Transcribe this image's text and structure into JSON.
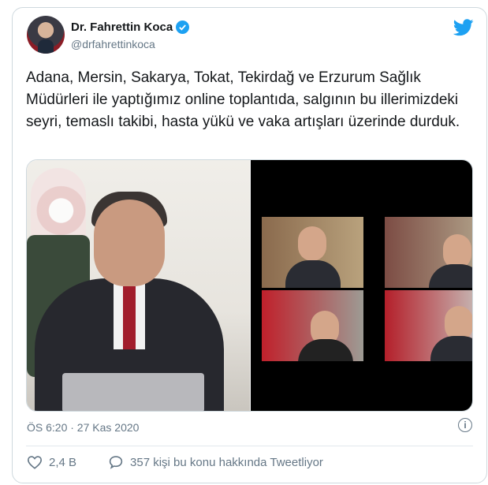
{
  "tweet": {
    "author_name": "Dr. Fahrettin Koca",
    "handle": "@drfahrettinkoca",
    "text": "Adana, Mersin, Sakarya, Tokat, Tekirdağ ve Erzurum Sağlık Müdürleri ile yaptığımız online toplantıda, salgının bu illerimizdeki seyri, temaslı takibi, hasta yükü ve vaka artışları üzerinde durduk.",
    "timestamp": "ÖS 6:20 · 27 Kas 2020",
    "likes": "2,4 B",
    "replies_text": "357 kişi bu konu hakkında Tweetliyor"
  },
  "colors": {
    "accent": "#1da1f2",
    "muted": "#657786",
    "border": "#cfd9de"
  },
  "icons": {
    "verified": "verified-badge-icon",
    "brand": "twitter-bird-icon",
    "info": "info-icon",
    "like": "heart-icon",
    "conversation": "speech-bubble-icon"
  }
}
